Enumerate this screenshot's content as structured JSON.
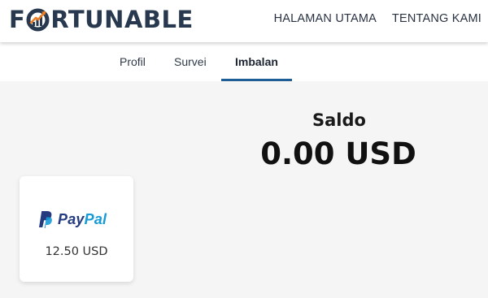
{
  "header": {
    "logo": {
      "prefix": "F",
      "suffix": "RTUNABLE"
    },
    "nav": [
      {
        "label": "HALAMAN UTAMA"
      },
      {
        "label": "TENTANG KAMI"
      }
    ]
  },
  "tabs": [
    {
      "label": "Profil",
      "active": false
    },
    {
      "label": "Survei",
      "active": false
    },
    {
      "label": "Imbalan",
      "active": true
    }
  ],
  "balance": {
    "label": "Saldo",
    "value": "0.00 USD"
  },
  "rewards": [
    {
      "provider": {
        "pay": "Pay",
        "pal": "Pal"
      },
      "icon": "paypal-icon",
      "amount": "12.50 USD"
    }
  ],
  "colors": {
    "brand_dark": "#27384f",
    "accent_orange": "#f07f23",
    "tab_underline": "#1e5c96",
    "paypal_dark": "#253b80",
    "paypal_light": "#179bd7"
  }
}
